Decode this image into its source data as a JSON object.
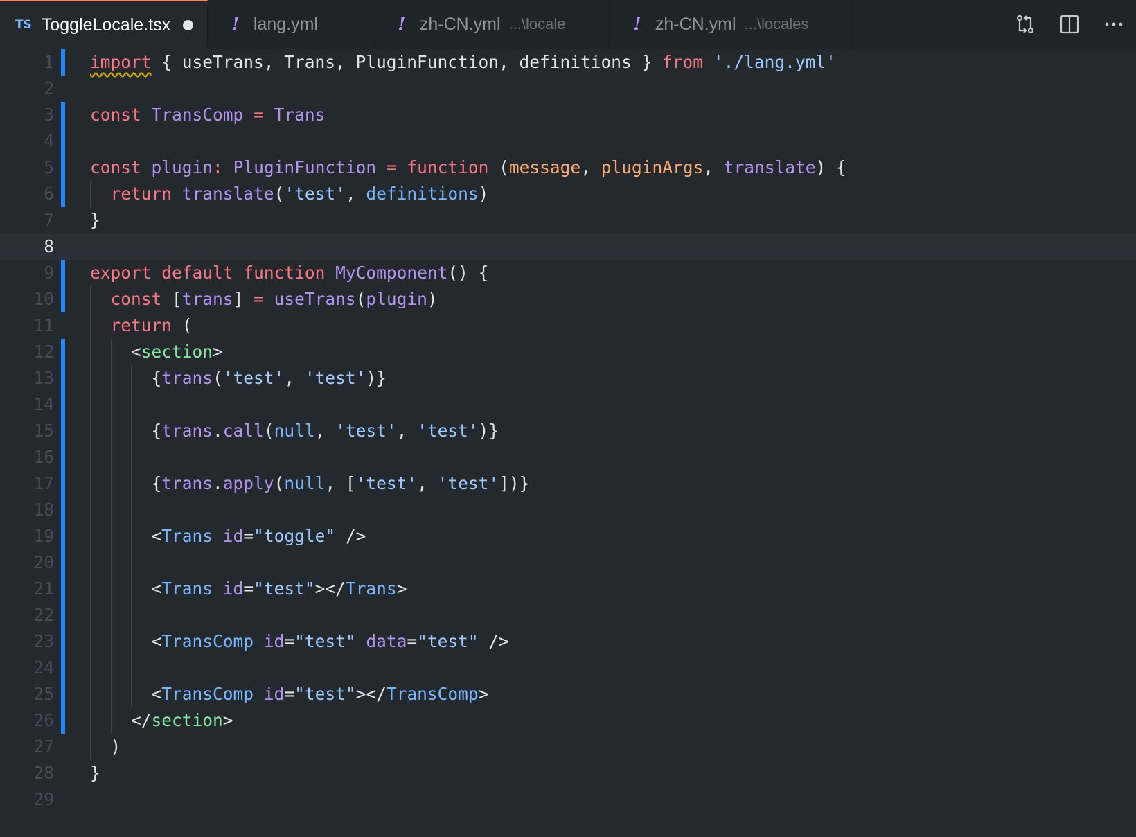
{
  "tabs": [
    {
      "badge": "TS",
      "label": "ToggleLocale.tsx",
      "path": "",
      "active": true,
      "modified": true,
      "width": 300
    },
    {
      "badge": "!",
      "label": "lang.yml",
      "path": "",
      "active": false,
      "modified": false,
      "width": 240
    },
    {
      "badge": "!",
      "label": "zh-CN.yml",
      "path": "...\\locale",
      "active": false,
      "modified": false,
      "width": 340
    },
    {
      "badge": "!",
      "label": "zh-CN.yml",
      "path": "...\\locales",
      "active": false,
      "modified": false,
      "width": 350
    }
  ],
  "actions": [
    {
      "name": "open-changes-button",
      "icon": "compare-changes-icon"
    },
    {
      "name": "split-editor-button",
      "icon": "split-editor-icon"
    },
    {
      "name": "more-actions-button",
      "icon": "ellipsis-icon"
    }
  ],
  "editor": {
    "current_line": 8,
    "lines": [
      {
        "n": 1,
        "gutter": true,
        "indent": 0,
        "tokens": [
          [
            "import",
            "kw sq"
          ],
          [
            " { useTrans, Trans, PluginFunction, definitions } ",
            ""
          ],
          [
            "from",
            "kw"
          ],
          [
            " ",
            ""
          ],
          [
            "'./lang.yml'",
            "str"
          ]
        ]
      },
      {
        "n": 2,
        "gutter": false,
        "indent": 0,
        "tokens": []
      },
      {
        "n": 3,
        "gutter": true,
        "indent": 0,
        "tokens": [
          [
            "const",
            "kw"
          ],
          [
            " ",
            ""
          ],
          [
            "TransComp",
            "fn"
          ],
          [
            " ",
            ""
          ],
          [
            "=",
            "kw"
          ],
          [
            " ",
            ""
          ],
          [
            "Trans",
            "fn"
          ]
        ]
      },
      {
        "n": 4,
        "gutter": true,
        "indent": 0,
        "tokens": []
      },
      {
        "n": 5,
        "gutter": true,
        "indent": 0,
        "tokens": [
          [
            "const",
            "kw"
          ],
          [
            " ",
            ""
          ],
          [
            "plugin",
            "fn"
          ],
          [
            ":",
            "kw"
          ],
          [
            " ",
            ""
          ],
          [
            "PluginFunction",
            "fn"
          ],
          [
            " ",
            ""
          ],
          [
            "=",
            "kw"
          ],
          [
            " ",
            ""
          ],
          [
            "function",
            "kw"
          ],
          [
            " (",
            ""
          ],
          [
            "message",
            "par"
          ],
          [
            ", ",
            ""
          ],
          [
            "pluginArgs",
            "par"
          ],
          [
            ", ",
            ""
          ],
          [
            "translate",
            "fn"
          ],
          [
            ") {",
            ""
          ]
        ]
      },
      {
        "n": 6,
        "gutter": true,
        "indent": 1,
        "tokens": [
          [
            "  ",
            ""
          ],
          [
            "return",
            "kw"
          ],
          [
            " ",
            ""
          ],
          [
            "translate",
            "fn"
          ],
          [
            "(",
            ""
          ],
          [
            "'test'",
            "str"
          ],
          [
            ", ",
            ""
          ],
          [
            "definitions",
            "var"
          ],
          [
            ")",
            ""
          ]
        ]
      },
      {
        "n": 7,
        "gutter": false,
        "indent": 0,
        "tokens": [
          [
            "}",
            ""
          ]
        ]
      },
      {
        "n": 8,
        "gutter": false,
        "indent": 0,
        "tokens": []
      },
      {
        "n": 9,
        "gutter": true,
        "indent": 0,
        "tokens": [
          [
            "export",
            "kw"
          ],
          [
            " ",
            ""
          ],
          [
            "default",
            "kw"
          ],
          [
            " ",
            ""
          ],
          [
            "function",
            "kw"
          ],
          [
            " ",
            ""
          ],
          [
            "MyComponent",
            "fn"
          ],
          [
            "() {",
            ""
          ]
        ]
      },
      {
        "n": 10,
        "gutter": true,
        "indent": 1,
        "tokens": [
          [
            "  ",
            ""
          ],
          [
            "const",
            "kw"
          ],
          [
            " [",
            ""
          ],
          [
            "trans",
            "fn"
          ],
          [
            "] ",
            ""
          ],
          [
            "=",
            "kw"
          ],
          [
            " ",
            ""
          ],
          [
            "useTrans",
            "fn"
          ],
          [
            "(",
            ""
          ],
          [
            "plugin",
            "fn"
          ],
          [
            ")",
            ""
          ]
        ]
      },
      {
        "n": 11,
        "gutter": false,
        "indent": 1,
        "tokens": [
          [
            "  ",
            ""
          ],
          [
            "return",
            "kw"
          ],
          [
            " (",
            ""
          ]
        ]
      },
      {
        "n": 12,
        "gutter": true,
        "indent": 2,
        "tokens": [
          [
            "    <",
            ""
          ],
          [
            "section",
            "tag"
          ],
          [
            ">",
            ""
          ]
        ]
      },
      {
        "n": 13,
        "gutter": true,
        "indent": 3,
        "tokens": [
          [
            "      {",
            ""
          ],
          [
            "trans",
            "fn"
          ],
          [
            "(",
            ""
          ],
          [
            "'test'",
            "str"
          ],
          [
            ", ",
            ""
          ],
          [
            "'test'",
            "str"
          ],
          [
            ")}",
            ""
          ]
        ]
      },
      {
        "n": 14,
        "gutter": true,
        "indent": 3,
        "tokens": []
      },
      {
        "n": 15,
        "gutter": true,
        "indent": 3,
        "tokens": [
          [
            "      {",
            ""
          ],
          [
            "trans",
            "fn"
          ],
          [
            ".",
            ""
          ],
          [
            "call",
            "fn"
          ],
          [
            "(",
            ""
          ],
          [
            "null",
            "var"
          ],
          [
            ", ",
            ""
          ],
          [
            "'test'",
            "str"
          ],
          [
            ", ",
            ""
          ],
          [
            "'test'",
            "str"
          ],
          [
            ")}",
            ""
          ]
        ]
      },
      {
        "n": 16,
        "gutter": true,
        "indent": 3,
        "tokens": []
      },
      {
        "n": 17,
        "gutter": true,
        "indent": 3,
        "tokens": [
          [
            "      {",
            ""
          ],
          [
            "trans",
            "fn"
          ],
          [
            ".",
            ""
          ],
          [
            "apply",
            "fn"
          ],
          [
            "(",
            ""
          ],
          [
            "null",
            "var"
          ],
          [
            ", [",
            ""
          ],
          [
            "'test'",
            "str"
          ],
          [
            ", ",
            ""
          ],
          [
            "'test'",
            "str"
          ],
          [
            "])}",
            ""
          ]
        ]
      },
      {
        "n": 18,
        "gutter": true,
        "indent": 3,
        "tokens": []
      },
      {
        "n": 19,
        "gutter": true,
        "indent": 3,
        "tokens": [
          [
            "      <",
            ""
          ],
          [
            "Trans",
            "var"
          ],
          [
            " ",
            ""
          ],
          [
            "id",
            "fn"
          ],
          [
            "=",
            ""
          ],
          [
            "\"toggle\"",
            "str"
          ],
          [
            " />",
            ""
          ]
        ]
      },
      {
        "n": 20,
        "gutter": true,
        "indent": 3,
        "tokens": []
      },
      {
        "n": 21,
        "gutter": true,
        "indent": 3,
        "tokens": [
          [
            "      <",
            ""
          ],
          [
            "Trans",
            "var"
          ],
          [
            " ",
            ""
          ],
          [
            "id",
            "fn"
          ],
          [
            "=",
            ""
          ],
          [
            "\"test\"",
            "str"
          ],
          [
            "></",
            ""
          ],
          [
            "Trans",
            "var"
          ],
          [
            ">",
            ""
          ]
        ]
      },
      {
        "n": 22,
        "gutter": true,
        "indent": 3,
        "tokens": []
      },
      {
        "n": 23,
        "gutter": true,
        "indent": 3,
        "tokens": [
          [
            "      <",
            ""
          ],
          [
            "TransComp",
            "var"
          ],
          [
            " ",
            ""
          ],
          [
            "id",
            "fn"
          ],
          [
            "=",
            ""
          ],
          [
            "\"test\"",
            "str"
          ],
          [
            " ",
            ""
          ],
          [
            "data",
            "fn"
          ],
          [
            "=",
            ""
          ],
          [
            "\"test\"",
            "str"
          ],
          [
            " />",
            ""
          ]
        ]
      },
      {
        "n": 24,
        "gutter": true,
        "indent": 3,
        "tokens": []
      },
      {
        "n": 25,
        "gutter": true,
        "indent": 3,
        "tokens": [
          [
            "      <",
            ""
          ],
          [
            "TransComp",
            "var"
          ],
          [
            " ",
            ""
          ],
          [
            "id",
            "fn"
          ],
          [
            "=",
            ""
          ],
          [
            "\"test\"",
            "str"
          ],
          [
            "></",
            ""
          ],
          [
            "TransComp",
            "var"
          ],
          [
            ">",
            ""
          ]
        ]
      },
      {
        "n": 26,
        "gutter": true,
        "indent": 2,
        "tokens": [
          [
            "    </",
            ""
          ],
          [
            "section",
            "tag"
          ],
          [
            ">",
            ""
          ]
        ]
      },
      {
        "n": 27,
        "gutter": false,
        "indent": 1,
        "tokens": [
          [
            "  )",
            ""
          ]
        ]
      },
      {
        "n": 28,
        "gutter": false,
        "indent": 0,
        "tokens": [
          [
            "}",
            ""
          ]
        ]
      },
      {
        "n": 29,
        "gutter": false,
        "indent": 0,
        "tokens": []
      }
    ]
  }
}
